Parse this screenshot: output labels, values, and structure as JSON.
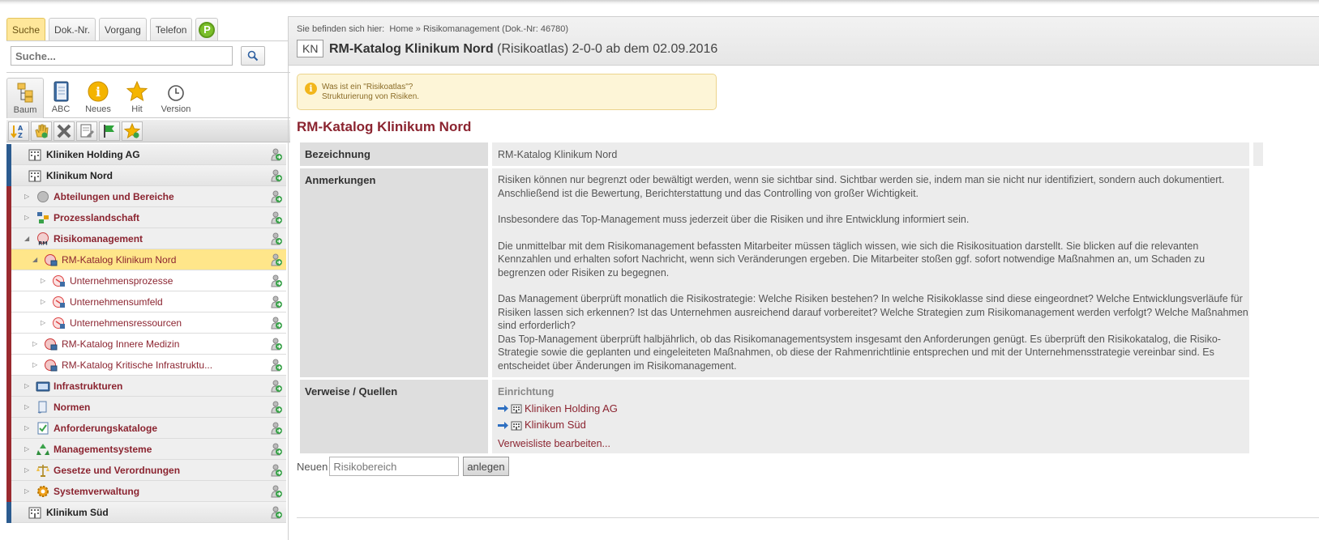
{
  "left": {
    "tabs": [
      "Suche",
      "Dok.-Nr.",
      "Vorgang",
      "Telefon"
    ],
    "p_tab_glyph": "P",
    "search_placeholder": "Suche...",
    "views": [
      "Baum",
      "ABC",
      "Neues",
      "Hit",
      "Version"
    ],
    "tree": [
      {
        "label": "Kliniken Holding AG",
        "level": 0,
        "icon": "building-icon"
      },
      {
        "label": "Klinikum Nord",
        "level": 0,
        "icon": "building-icon"
      },
      {
        "label": "Abteilungen und Bereiche",
        "level": 1,
        "icon": "circle-icon"
      },
      {
        "label": "Prozesslandschaft",
        "level": 1,
        "icon": "process-icon"
      },
      {
        "label": "Risikomanagement",
        "level": 1,
        "icon": "rm-icon"
      },
      {
        "label": "RM-Katalog Klinikum Nord",
        "level": 2,
        "icon": "risk-catalog-icon",
        "selected": true
      },
      {
        "label": "Unternehmensprozesse",
        "level": 3,
        "icon": "risk-area-icon"
      },
      {
        "label": "Unternehmensumfeld",
        "level": 3,
        "icon": "risk-area-icon"
      },
      {
        "label": "Unternehmensressourcen",
        "level": 3,
        "icon": "risk-area-icon"
      },
      {
        "label": "RM-Katalog Innere Medizin",
        "level": 2,
        "icon": "risk-catalog-icon"
      },
      {
        "label": "RM-Katalog Kritische Infrastruktu...",
        "level": 2,
        "icon": "risk-catalog-icon"
      },
      {
        "label": "Infrastrukturen",
        "level": 1,
        "icon": "infrastructure-icon"
      },
      {
        "label": "Normen",
        "level": 1,
        "icon": "norm-icon"
      },
      {
        "label": "Anforderungskataloge",
        "level": 1,
        "icon": "checklist-icon"
      },
      {
        "label": "Managementsysteme",
        "level": 1,
        "icon": "recycle-icon"
      },
      {
        "label": "Gesetze und Verordnungen",
        "level": 1,
        "icon": "scales-icon"
      },
      {
        "label": "Systemverwaltung",
        "level": 1,
        "icon": "cog-icon"
      },
      {
        "label": "Klinikum Süd",
        "level": 0,
        "icon": "building-icon"
      }
    ]
  },
  "main": {
    "breadcrumb_prefix": "Sie befinden sich hier:",
    "breadcrumb_home": "Home",
    "breadcrumb_sep": "»",
    "breadcrumb_current": "Risikomanagement (Dok.-Nr: 46780)",
    "badge": "KN",
    "title": "RM-Katalog Klinikum Nord",
    "title_type": "(Risikoatlas)",
    "title_version": "2-0-0 ab dem 02.09.2016",
    "info_line1": "Was ist ein \"Risikoatlas\"?",
    "info_line2": "Strukturierung von Risiken.",
    "heading": "RM-Katalog Klinikum Nord",
    "rows": {
      "bezeichnung_label": "Bezeichnung",
      "bezeichnung_value": "RM-Katalog Klinikum Nord",
      "anmerkungen_label": "Anmerkungen",
      "anmerkungen_p1": "Risiken können nur begrenzt oder bewältigt werden, wenn sie sichtbar sind. Sichtbar werden sie, indem man sie nicht nur identifiziert, sondern auch dokumentiert. Anschließend ist die Bewertung, Berichterstattung und das Controlling von großer Wichtigkeit.",
      "anmerkungen_p2": "Insbesondere das Top-Management muss jederzeit über die Risiken und ihre Entwicklung informiert sein.",
      "anmerkungen_p3": "Die unmittelbar mit dem Risikomanagement befassten Mitarbeiter müssen täglich wissen, wie sich die Risikosituation darstellt. Sie blicken auf die relevanten Kennzahlen und erhalten sofort Nachricht, wenn sich Veränderungen ergeben. Die Mitarbeiter stoßen ggf. sofort notwendige Maßnahmen an, um Schaden zu begrenzen oder Risiken zu begegnen.",
      "anmerkungen_p4": "Das Management überprüft monatlich die Risikostrategie: Welche Risiken bestehen? In welche Risikoklasse sind diese eingeordnet? Welche Entwicklungsverläufe für Risiken lassen sich erkennen? Ist das Unternehmen ausreichend darauf vorbereitet? Welche Strategien zum Risikomanagement werden verfolgt? Welche Maßnahmen sind erforderlich?",
      "anmerkungen_p5": "Das Top-Management überprüft halbjährlich, ob das Risikomanagementsystem insgesamt den Anforderungen genügt. Es überprüft den Risikokatalog, die Risiko-Strategie sowie die geplanten und eingeleiteten Maßnahmen, ob diese der Rahmenrichtlinie entsprechen und mit der Unternehmensstrategie vereinbar sind. Es entscheidet über Änderungen im Risikomanagement.",
      "verweise_label": "Verweise / Quellen",
      "einrichtung": "Einrichtung",
      "ref1": "Kliniken Holding AG",
      "ref2": "Klinikum Süd",
      "edit_refs": "Verweisliste bearbeiten..."
    },
    "new_label": "Neuen",
    "new_input_value": "Risikobereich",
    "new_button": "anlegen"
  },
  "colors": {
    "accent_red": "#8b2430",
    "selected_yellow": "#ffe68a",
    "info_bg": "#fdf5d7"
  }
}
